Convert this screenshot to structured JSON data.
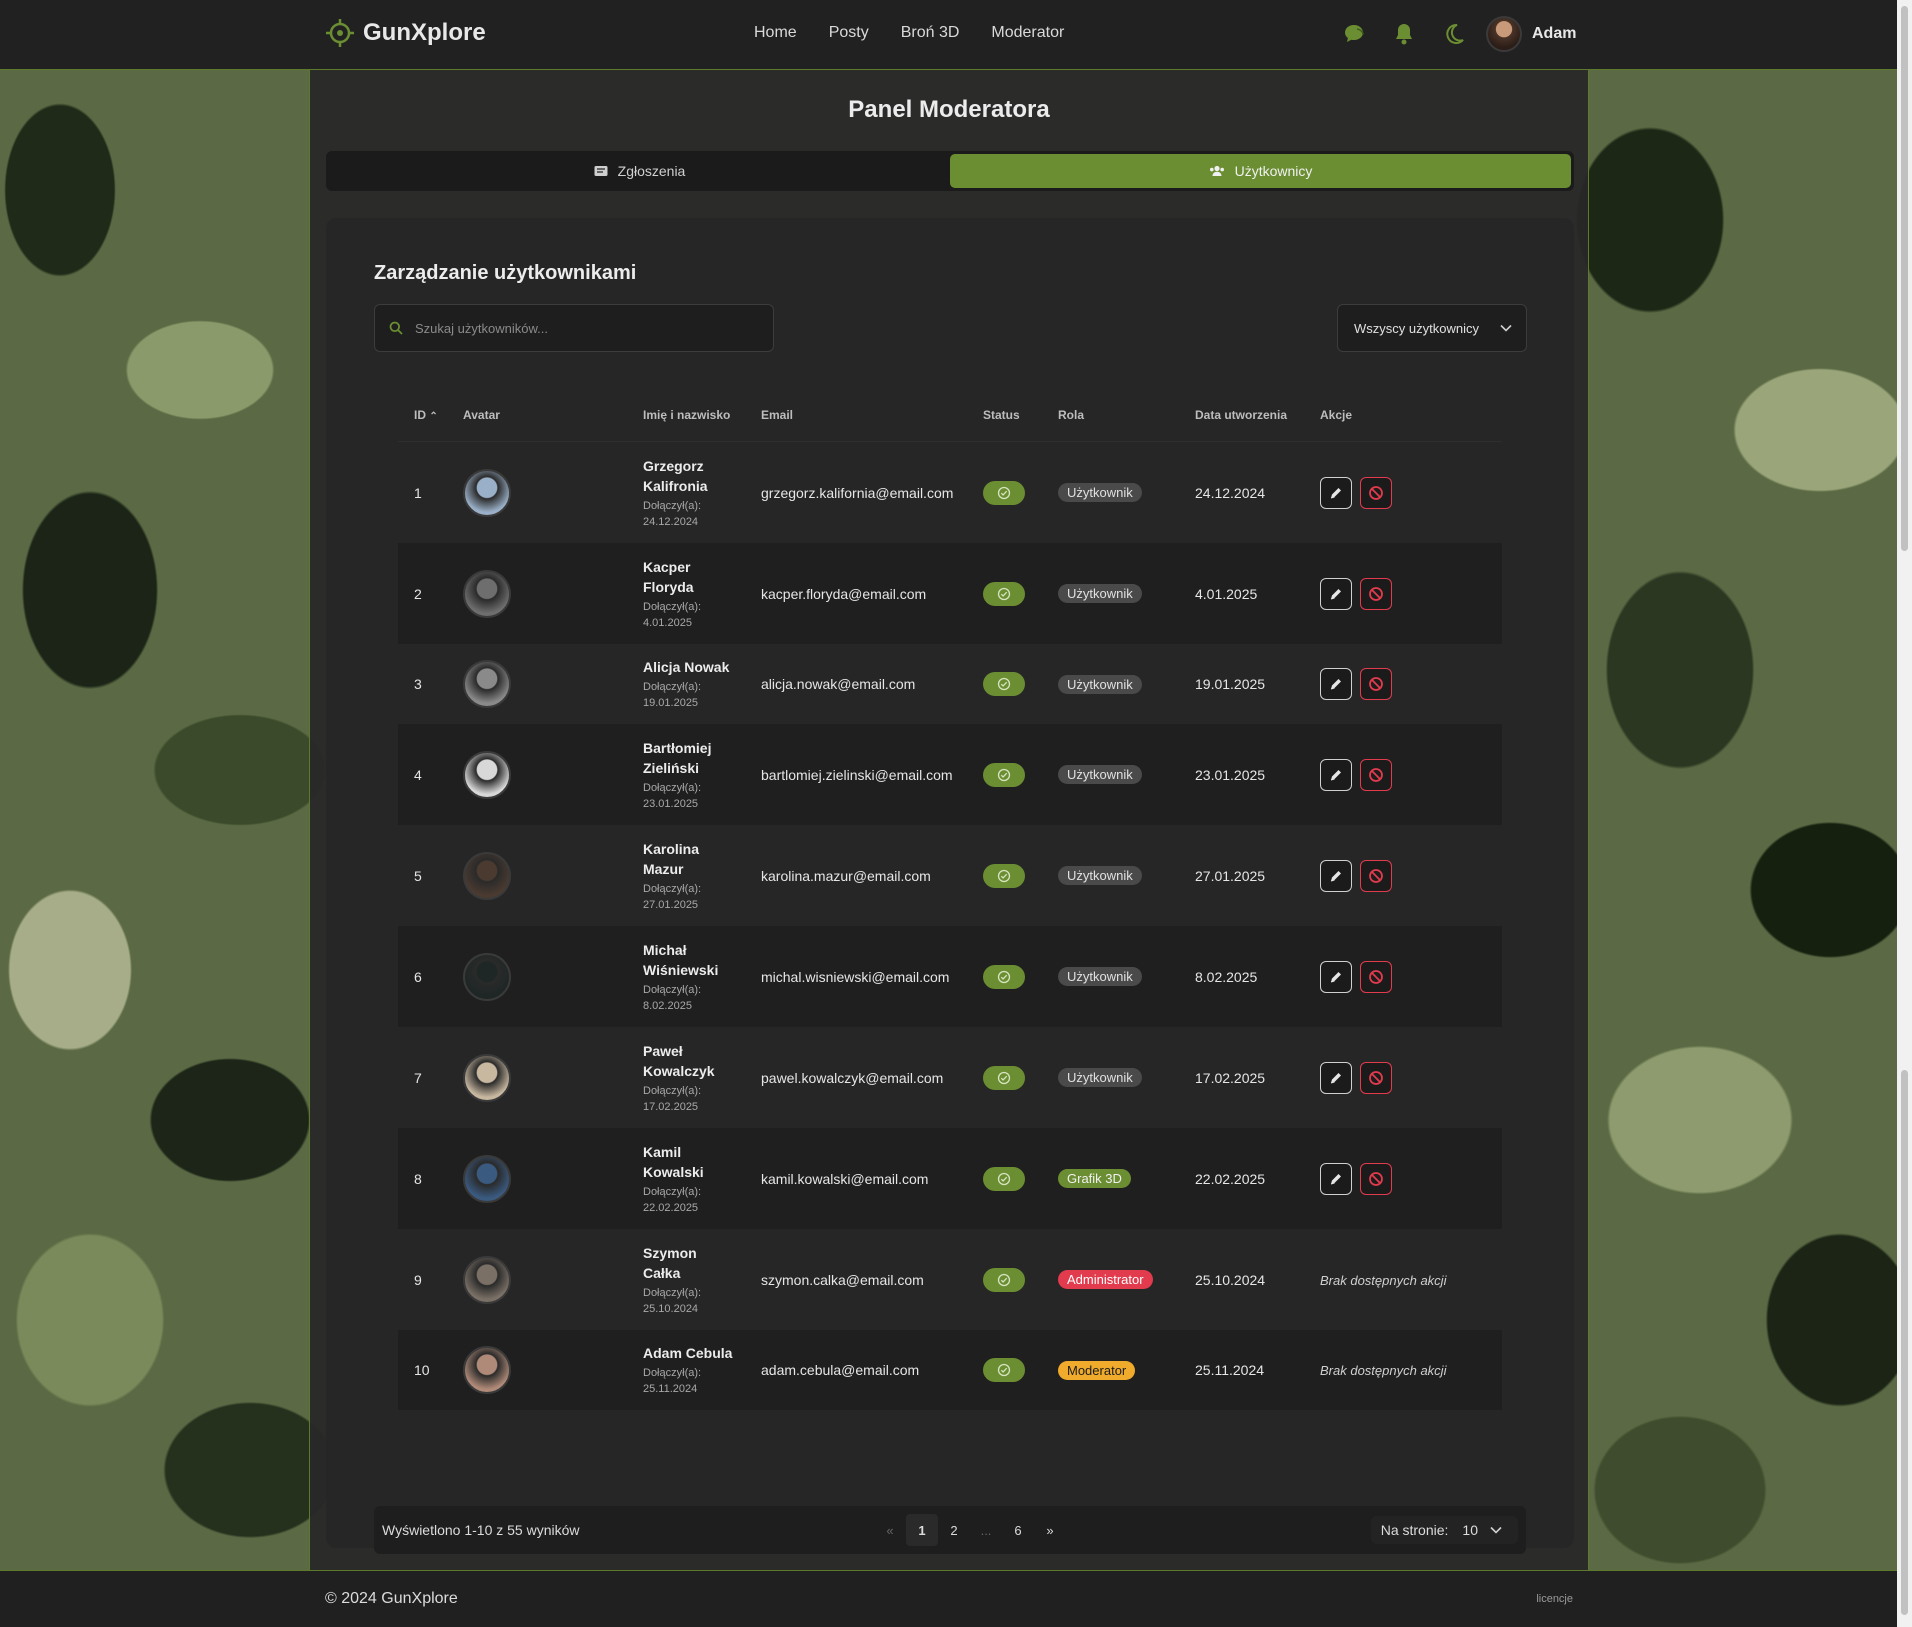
{
  "app": {
    "name": "GunXplore"
  },
  "nav": {
    "home": "Home",
    "posts": "Posty",
    "weapons": "Broń 3D",
    "moderator": "Moderator"
  },
  "user": {
    "name": "Adam"
  },
  "page": {
    "title": "Panel Moderatora"
  },
  "tabs": {
    "reports": "Zgłoszenia",
    "users": "Użytkownicy",
    "active": "users"
  },
  "section": {
    "title": "Zarządzanie użytkownikami"
  },
  "search": {
    "placeholder": "Szukaj użytkowników..."
  },
  "filter": {
    "value": "Wszyscy użytkownicy"
  },
  "table": {
    "headers": {
      "id": "ID",
      "avatar": "Avatar",
      "name": "Imię i nazwisko",
      "email": "Email",
      "status": "Status",
      "role": "Rola",
      "created": "Data utworzenia",
      "actions": "Akcje"
    },
    "joined_label": "Dołączył(a):",
    "no_actions": "Brak dostępnych akcji",
    "rows": [
      {
        "id": "1",
        "name_1": "Grzegorz",
        "name_2": "Kalifronia",
        "joined": "24.12.2024",
        "email": "grzegorz.kalifornia@email.com",
        "role": "Użytkownik",
        "role_kind": "user",
        "created": "24.12.2024",
        "actions": true,
        "avatar_color": "#9ab0c8"
      },
      {
        "id": "2",
        "name_1": "Kacper",
        "name_2": "Floryda",
        "joined": "4.01.2025",
        "email": "kacper.floryda@email.com",
        "role": "Użytkownik",
        "role_kind": "user",
        "created": "4.01.2025",
        "actions": true,
        "avatar_color": "#6e6e6e"
      },
      {
        "id": "3",
        "name_1": "Alicja Nowak",
        "name_2": "",
        "joined": "19.01.2025",
        "email": "alicja.nowak@email.com",
        "role": "Użytkownik",
        "role_kind": "user",
        "created": "19.01.2025",
        "actions": true,
        "avatar_color": "#8a8a8a"
      },
      {
        "id": "4",
        "name_1": "Bartłomiej",
        "name_2": "Zieliński",
        "joined": "23.01.2025",
        "email": "bartlomiej.zielinski@email.com",
        "role": "Użytkownik",
        "role_kind": "user",
        "created": "23.01.2025",
        "actions": true,
        "avatar_color": "#d8d8d8"
      },
      {
        "id": "5",
        "name_1": "Karolina",
        "name_2": "Mazur",
        "joined": "27.01.2025",
        "email": "karolina.mazur@email.com",
        "role": "Użytkownik",
        "role_kind": "user",
        "created": "27.01.2025",
        "actions": true,
        "avatar_color": "#4a3a30"
      },
      {
        "id": "6",
        "name_1": "Michał",
        "name_2": "Wiśniewski",
        "joined": "8.02.2025",
        "email": "michal.wisniewski@email.com",
        "role": "Użytkownik",
        "role_kind": "user",
        "created": "8.02.2025",
        "actions": true,
        "avatar_color": "#1e2626"
      },
      {
        "id": "7",
        "name_1": "Paweł",
        "name_2": "Kowalczyk",
        "joined": "17.02.2025",
        "email": "pawel.kowalczyk@email.com",
        "role": "Użytkownik",
        "role_kind": "user",
        "created": "17.02.2025",
        "actions": true,
        "avatar_color": "#c8b8a0"
      },
      {
        "id": "8",
        "name_1": "Kamil",
        "name_2": "Kowalski",
        "joined": "22.02.2025",
        "email": "kamil.kowalski@email.com",
        "role": "Grafik 3D",
        "role_kind": "3d",
        "created": "22.02.2025",
        "actions": true,
        "avatar_color": "#3a5a80"
      },
      {
        "id": "9",
        "name_1": "Szymon",
        "name_2": "Całka",
        "joined": "25.10.2024",
        "email": "szymon.calka@email.com",
        "role": "Administrator",
        "role_kind": "admin",
        "created": "25.10.2024",
        "actions": false,
        "avatar_color": "#7a7066"
      },
      {
        "id": "10",
        "name_1": "Adam Cebula",
        "name_2": "",
        "joined": "25.11.2024",
        "email": "adam.cebula@email.com",
        "role": "Moderator",
        "role_kind": "mod",
        "created": "25.11.2024",
        "actions": false,
        "avatar_color": "#b08a78"
      }
    ]
  },
  "pagination": {
    "info": "Wyświetlono 1-10 z 55 wyników",
    "prev": "«",
    "next": "»",
    "pages": [
      "1",
      "2",
      "...",
      "6"
    ],
    "current": "1",
    "per_page_label": "Na stronie:",
    "per_page_value": "10"
  },
  "footer": {
    "copyright": "© 2024 GunXplore",
    "license": "licencje"
  },
  "colors": {
    "accent": "#6b8e32",
    "danger": "#e23b4e",
    "warning": "#f0ab2c"
  }
}
